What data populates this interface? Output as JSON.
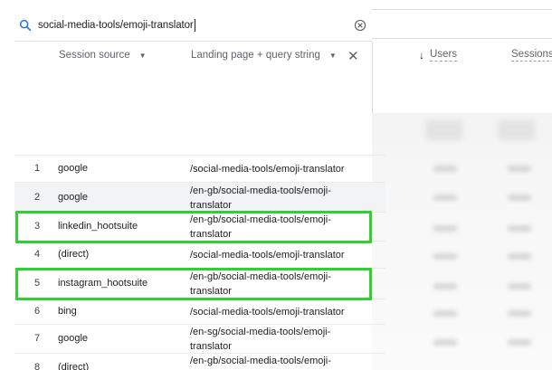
{
  "search": {
    "query": "social-media-tools/emoji-translator",
    "search_icon": "search-icon",
    "clear_icon": "clear-circle-icon"
  },
  "columns": {
    "dim1": "Session source",
    "dim2": "Landing page + query string",
    "remove_icon": "close-icon",
    "metric1": "Users",
    "metric1_sort_icon": "arrow-down-icon",
    "metric2": "Sessions"
  },
  "rows": [
    {
      "index": "1",
      "source": "google",
      "landing": "/social-media-tools/emoji-translator",
      "highlighted": false
    },
    {
      "index": "2",
      "source": "google",
      "landing": "/en-gb/social-media-tools/emoji-translator",
      "highlighted": false
    },
    {
      "index": "3",
      "source": "linkedin_hootsuite",
      "landing": "/en-gb/social-media-tools/emoji-translator",
      "highlighted": true
    },
    {
      "index": "4",
      "source": "(direct)",
      "landing": "/social-media-tools/emoji-translator",
      "highlighted": false
    },
    {
      "index": "5",
      "source": "instagram_hootsuite",
      "landing": "/en-gb/social-media-tools/emoji-translator",
      "highlighted": true
    },
    {
      "index": "6",
      "source": "bing",
      "landing": "/social-media-tools/emoji-translator",
      "highlighted": false
    },
    {
      "index": "7",
      "source": "google",
      "landing": "/en-sg/social-media-tools/emoji-translator",
      "highlighted": false
    },
    {
      "index": "8",
      "source": "(direct)",
      "landing": "/en-gb/social-media-tools/emoji-translator",
      "highlighted": false
    }
  ],
  "colors": {
    "highlight": "#2ed12e",
    "row_shade": "#f1f3f4",
    "divider": "#dadce0"
  }
}
